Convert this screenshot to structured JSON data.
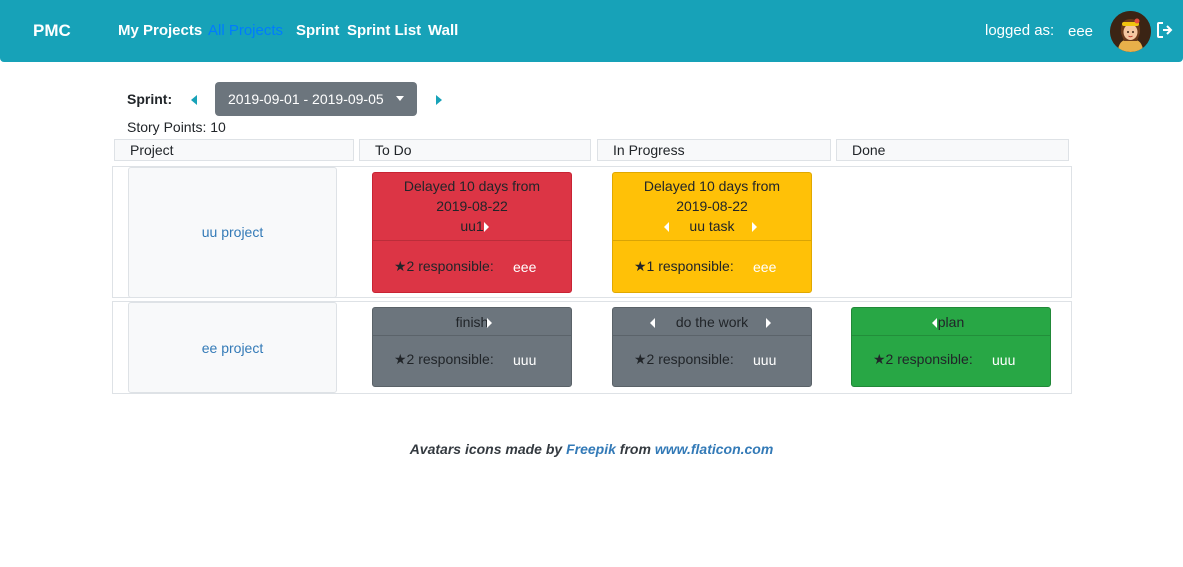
{
  "navbar": {
    "brand": "PMC",
    "links": [
      "My Projects",
      "All Projects",
      "Sprint",
      "Sprint List",
      "Wall"
    ],
    "active_link": "All Projects",
    "logged_label": "logged as:",
    "logged_user": "eee",
    "background": "#17a2b8",
    "active_color": "#007bff"
  },
  "sprint": {
    "label": "Sprint:",
    "range": "2019-09-01 - 2019-09-05",
    "points_label": "Story Points: 10"
  },
  "columns": [
    "Project",
    "To Do",
    "In Progress",
    "Done"
  ],
  "rows": [
    {
      "project": "uu project",
      "todo": {
        "delay": "Delayed 10 days from",
        "date": "2019-08-22",
        "title": "uu1",
        "points": "★2 responsible:",
        "user": "eee",
        "color": "#dc3545"
      },
      "in_progress": {
        "delay": "Delayed 10 days from",
        "date": "2019-08-22",
        "title": "uu task",
        "points": "★1 responsible:",
        "user": "eee",
        "color": "#ffc107"
      }
    },
    {
      "project": "ee project",
      "todo": {
        "title": "finish",
        "points": "★2 responsible:",
        "user": "uuu",
        "color": "#6c757d"
      },
      "in_progress": {
        "title": "do the work",
        "points": "★2 responsible:",
        "user": "uuu",
        "color": "#6c757d"
      },
      "done": {
        "title": "plan",
        "points": "★2 responsible:",
        "user": "uuu",
        "color": "#28a745"
      }
    }
  ],
  "footer": {
    "prefix": "Avatars icons made by",
    "author": "Freepik",
    "middle": "from",
    "site": "www.flaticon.com"
  },
  "icons": [
    "avatar",
    "logout-icon",
    "caret-left-icon",
    "caret-right-icon",
    "caret-down-icon"
  ]
}
